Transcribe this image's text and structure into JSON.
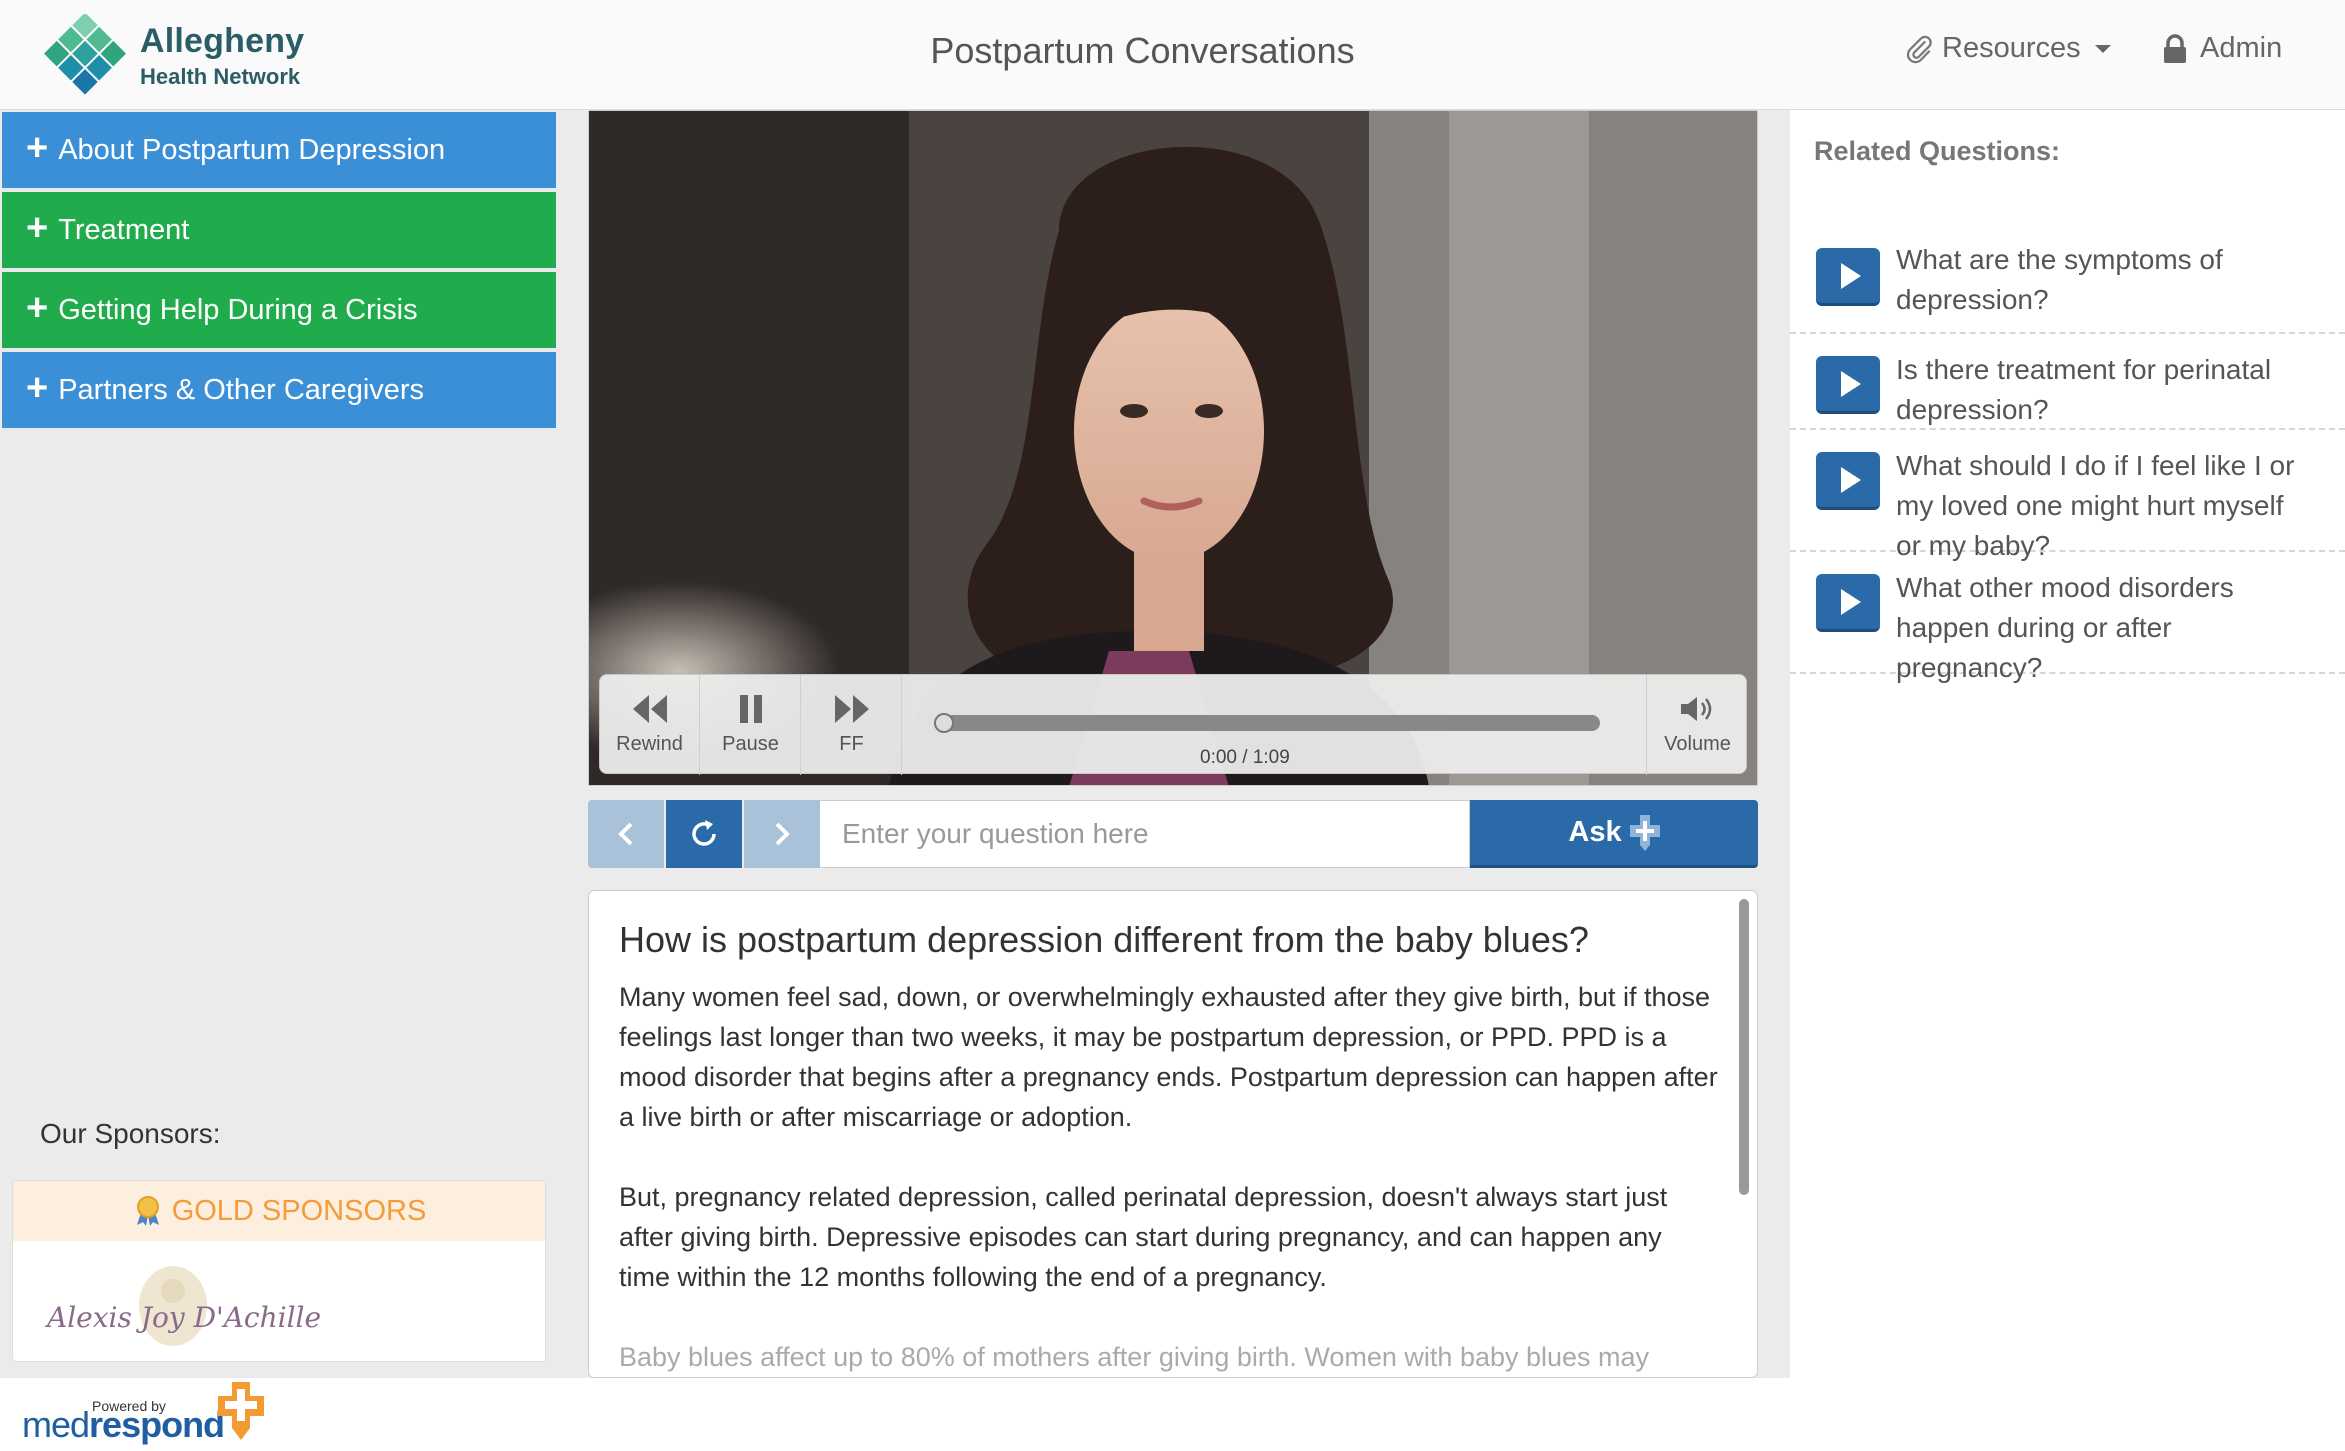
{
  "header": {
    "logo_name": "Allegheny",
    "logo_sub": "Health Network",
    "title": "Postpartum Conversations",
    "resources_label": "Resources",
    "admin_label": "Admin"
  },
  "sidebar": {
    "items": [
      {
        "label": "About Postpartum Depression",
        "color": "#3b8fd7"
      },
      {
        "label": "Treatment",
        "color": "#20ac4c"
      },
      {
        "label": "Getting Help During a Crisis",
        "color": "#20ac4c"
      },
      {
        "label": "Partners & Other Caregivers",
        "color": "#3b8fd7"
      }
    ],
    "sponsors_label": "Our Sponsors:",
    "sponsor_tier": "GOLD SPONSORS",
    "sponsor_name": "Alexis Joy D'Achille"
  },
  "player": {
    "rewind_label": "Rewind",
    "pause_label": "Pause",
    "ff_label": "FF",
    "volume_label": "Volume",
    "time": "0:00 / 1:09",
    "progress": 0
  },
  "ask": {
    "placeholder": "Enter your question here",
    "button_label": "Ask"
  },
  "answer": {
    "question": "How is postpartum depression different from the baby blues?",
    "paragraphs": [
      "Many women feel sad, down, or overwhelmingly exhausted after they give birth, but if those feelings last longer than two weeks, it may be postpartum depression, or PPD. PPD is a mood disorder that begins after a pregnancy ends. Postpartum depression can happen after a live birth or after miscarriage or adoption.",
      "But, pregnancy related depression, called perinatal depression, doesn't always start just after giving birth. Depressive episodes can start during pregnancy, and can happen any time within the 12 months following the end of a pregnancy.",
      "Baby blues affect up to 80% of mothers after giving birth. Women with baby blues may"
    ]
  },
  "related": {
    "title": "Related Questions:",
    "items": [
      {
        "label": "What are the symptoms of depression?"
      },
      {
        "label": "Is there treatment for perinatal depression?"
      },
      {
        "label": "What should I do if I feel like I or my loved one might hurt myself or my baby?"
      },
      {
        "label": "What other mood disorders happen during or after pregnancy?"
      }
    ]
  },
  "footer": {
    "powered_by": "Powered by",
    "brand_light": "med",
    "brand_bold": "respond"
  },
  "colors": {
    "accent_blue": "#2b6aa8",
    "menu_blue": "#3b8fd7",
    "menu_green": "#20ac4c",
    "gold": "#f49b3a"
  }
}
